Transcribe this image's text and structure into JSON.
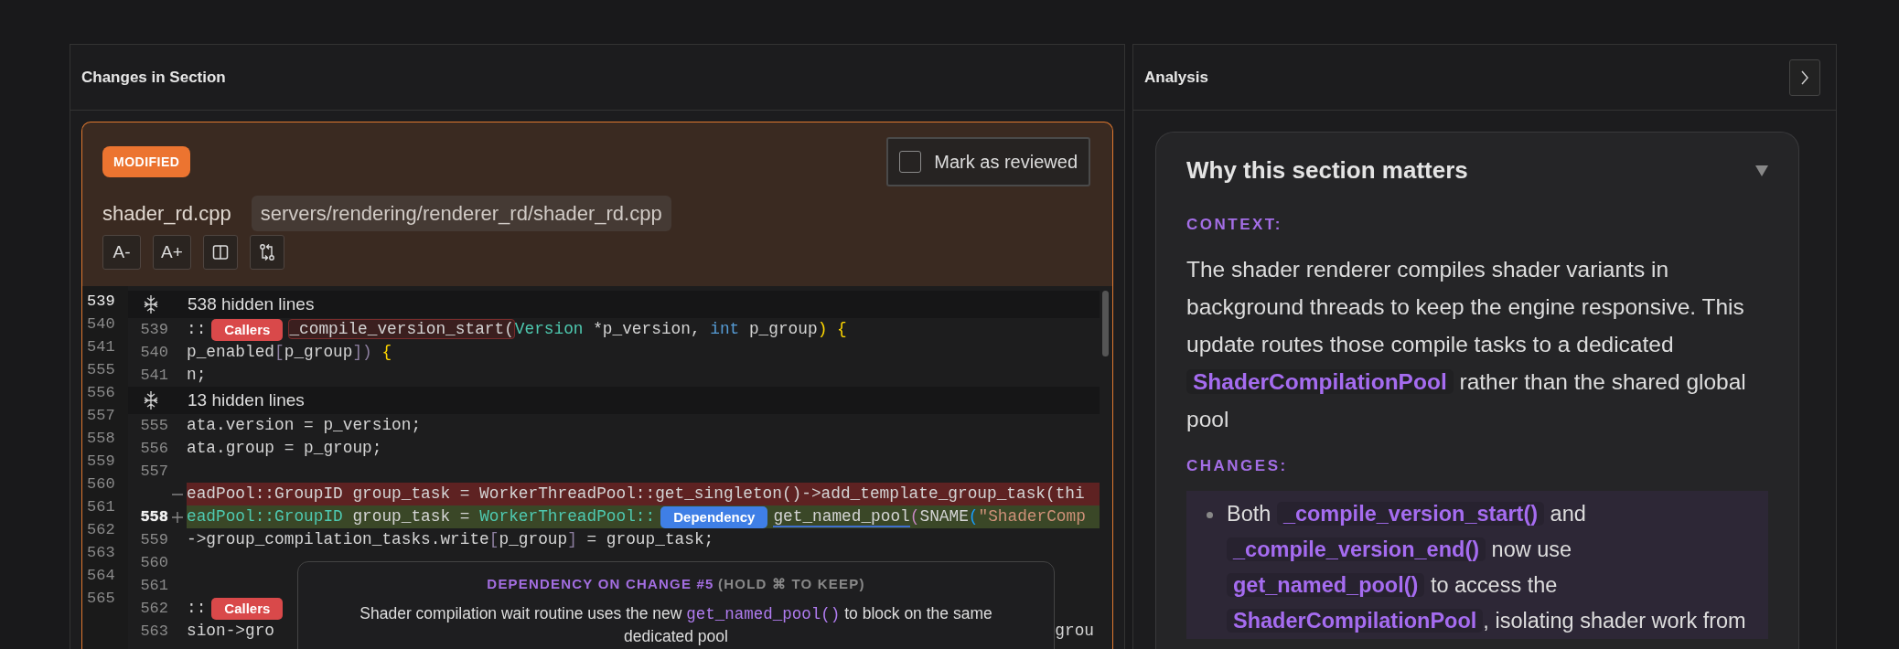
{
  "changes_panel": {
    "title": "Changes in Section",
    "file": {
      "status": "MODIFIED",
      "name": "shader_rd.cpp",
      "path": "servers/rendering/renderer_rd/shader_rd.cpp",
      "review": {
        "label": "Mark as reviewed",
        "checked": false
      },
      "tools": [
        {
          "kind": "text",
          "label": "A-"
        },
        {
          "kind": "text",
          "label": "A+"
        },
        {
          "kind": "split"
        },
        {
          "kind": "compare"
        }
      ]
    },
    "gutter": [
      {
        "n": "539",
        "current": true
      },
      {
        "n": "540",
        "current": false
      },
      {
        "n": "541",
        "current": false
      },
      {
        "n": "555",
        "current": false
      },
      {
        "n": "556",
        "current": false
      },
      {
        "n": "557",
        "current": false
      },
      {
        "n": "558",
        "current": false
      },
      {
        "n": "559",
        "current": false
      },
      {
        "n": "560",
        "current": false
      },
      {
        "n": "561",
        "current": false
      },
      {
        "n": "562",
        "current": false
      },
      {
        "n": "563",
        "current": false
      },
      {
        "n": "564",
        "current": false
      },
      {
        "n": "565",
        "current": false
      }
    ],
    "rows": [
      {
        "kind": "hidden",
        "label": "538 hidden lines"
      },
      {
        "kind": "code",
        "num": "539",
        "current": false,
        "segments": [
          {
            "t": "::",
            "kind": "plain"
          },
          {
            "t": "Callers",
            "kind": "badge"
          },
          {
            "t": "_compile_version_start(",
            "kind": "ref"
          },
          {
            "t": "Version",
            "kind": "type"
          },
          {
            "t": " *p_version, ",
            "kind": "plain"
          },
          {
            "t": "int",
            "kind": "keyword"
          },
          {
            "t": " p_group",
            "kind": "plain"
          },
          {
            "t": ") {",
            "kind": "punct"
          }
        ]
      },
      {
        "kind": "code",
        "num": "540",
        "current": false,
        "segments": [
          {
            "t": "p_enabled",
            "kind": "plain"
          },
          {
            "t": "[",
            "kind": "bracket"
          },
          {
            "t": "p_group",
            "kind": "plain"
          },
          {
            "t": "])",
            "kind": "bracket"
          },
          {
            "t": " {",
            "kind": "punct"
          }
        ]
      },
      {
        "kind": "code",
        "num": "541",
        "current": false,
        "segments": [
          {
            "t": "n;",
            "kind": "plain"
          }
        ]
      },
      {
        "kind": "hidden",
        "label": "13 hidden lines"
      },
      {
        "kind": "code",
        "num": "555",
        "current": false,
        "segments": [
          {
            "t": "ata.version = p_version;",
            "kind": "plain"
          }
        ]
      },
      {
        "kind": "code",
        "num": "556",
        "current": false,
        "segments": [
          {
            "t": "ata.group = p_group;",
            "kind": "plain"
          }
        ]
      },
      {
        "kind": "code",
        "num": "557",
        "current": false,
        "segments": []
      },
      {
        "kind": "removed",
        "segments": [
          {
            "t": "eadPool::GroupID group_task = WorkerThreadPool::get_singleton()->add_template_group_task(thi",
            "kind": "plain"
          }
        ]
      },
      {
        "kind": "added",
        "num": "558",
        "current": true,
        "segments": [
          {
            "t": "eadPool::GroupID",
            "kind": "type"
          },
          {
            "t": " group_task = ",
            "kind": "plain"
          },
          {
            "t": "WorkerThreadPool::",
            "kind": "type"
          },
          {
            "t": "Dependency",
            "kind": "dep-badge"
          },
          {
            "t": "get_named_pool",
            "kind": "dep-ref"
          },
          {
            "t": "(",
            "kind": "paren"
          },
          {
            "t": "SNAME",
            "kind": "plain"
          },
          {
            "t": "(",
            "kind": "paren2"
          },
          {
            "t": "\"ShaderComp",
            "kind": "string"
          }
        ]
      },
      {
        "kind": "code",
        "num": "559",
        "current": false,
        "segments": [
          {
            "t": "->group_compilation_tasks.write",
            "kind": "plain"
          },
          {
            "t": "[",
            "kind": "bracket"
          },
          {
            "t": "p_group",
            "kind": "plain"
          },
          {
            "t": "]",
            "kind": "bracket"
          },
          {
            "t": " = group_task;",
            "kind": "plain"
          }
        ]
      },
      {
        "kind": "code",
        "num": "560",
        "current": false,
        "segments": []
      },
      {
        "kind": "code",
        "num": "561",
        "current": false,
        "segments": []
      },
      {
        "kind": "code",
        "num": "562",
        "current": false,
        "segments": [
          {
            "t": "::",
            "kind": "plain"
          },
          {
            "t": "Callers",
            "kind": "badge"
          }
        ]
      },
      {
        "kind": "code",
        "num": "563",
        "current": false,
        "segments": [
          {
            "t": "sion->gro",
            "kind": "plain"
          }
        ],
        "tail": "grou"
      }
    ],
    "tooltip": {
      "title": "DEPENDENCY ON CHANGE #5",
      "hint": "(HOLD ⌘ TO KEEP)",
      "text": "Shader compilation wait routine uses the new **get_named_pool()** to block on the same dedicated pool"
    }
  },
  "analysis_panel": {
    "title": "Analysis",
    "card": {
      "title": "Why this section matters",
      "expanded": true,
      "sections": [
        {
          "kind": "text",
          "heading": "CONTEXT:",
          "text": "The shader renderer compiles shader variants in background threads to keep the engine responsive. This update routes those compile tasks to a dedicated **ShaderCompilationPool** rather than the shared global pool"
        },
        {
          "kind": "list",
          "heading": "CHANGES:",
          "items": [
            "Both **_compile_version_start()** and **_compile_version_end()** now use **get_named_pool()** to access the **ShaderCompilationPool**, isolating shader work from"
          ]
        }
      ]
    }
  }
}
